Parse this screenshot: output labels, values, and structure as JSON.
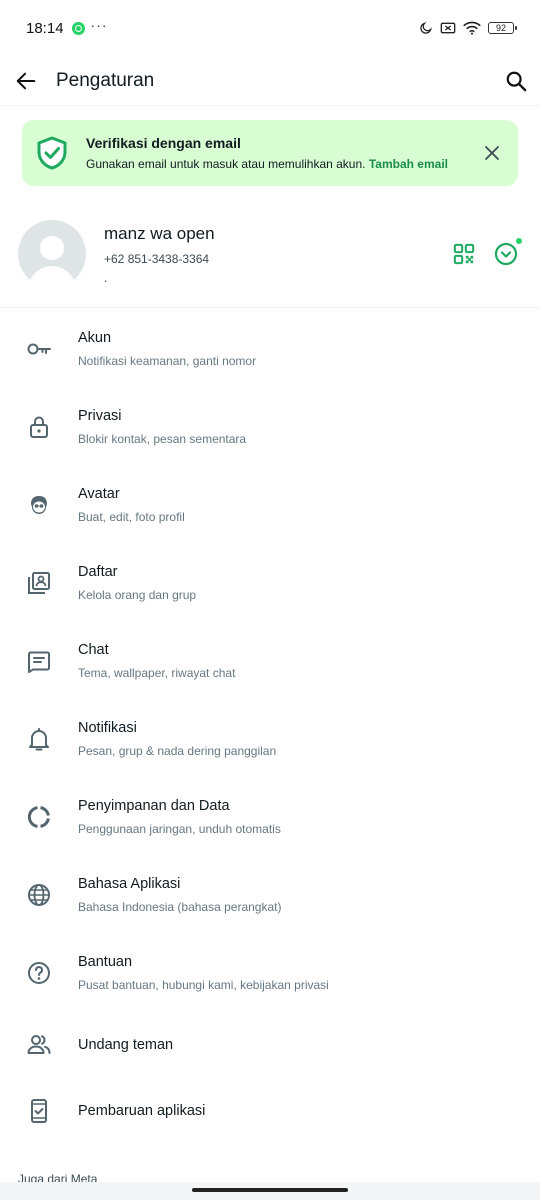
{
  "status_bar": {
    "time": "18:14",
    "dots": "···",
    "battery": "92",
    "icons": [
      "whatsapp-notification-icon",
      "moon-icon",
      "screen-record-icon",
      "wifi-icon",
      "battery-icon"
    ]
  },
  "app_bar": {
    "title": "Pengaturan",
    "icons": [
      "back-arrow-icon",
      "search-icon"
    ]
  },
  "email_banner": {
    "title": "Verifikasi dengan email",
    "description": "Gunakan email untuk masuk atau memulihkan akun.",
    "link": "Tambah email",
    "icons": [
      "shield-check-icon",
      "close-icon"
    ]
  },
  "profile": {
    "name": "manz wa open",
    "phone": "+62 851-3438-3364",
    "about": ".",
    "icons": [
      "qr-code-icon",
      "status-chevron-icon"
    ]
  },
  "settings": [
    {
      "title": "Akun",
      "subtitle": "Notifikasi keamanan, ganti nomor",
      "icon": "key-icon"
    },
    {
      "title": "Privasi",
      "subtitle": "Blokir kontak, pesan sementara",
      "icon": "lock-icon"
    },
    {
      "title": "Avatar",
      "subtitle": "Buat, edit, foto profil",
      "icon": "avatar-face-icon"
    },
    {
      "title": "Daftar",
      "subtitle": "Kelola orang dan grup",
      "icon": "contact-list-icon"
    },
    {
      "title": "Chat",
      "subtitle": "Tema, wallpaper, riwayat chat",
      "icon": "chat-icon"
    },
    {
      "title": "Notifikasi",
      "subtitle": "Pesan, grup & nada dering panggilan",
      "icon": "bell-icon"
    },
    {
      "title": "Penyimpanan dan Data",
      "subtitle": "Penggunaan jaringan, unduh otomatis",
      "icon": "storage-icon"
    },
    {
      "title": "Bahasa Aplikasi",
      "subtitle": "Bahasa Indonesia (bahasa perangkat)",
      "icon": "globe-icon"
    },
    {
      "title": "Bantuan",
      "subtitle": "Pusat bantuan, hubungi kami, kebijakan privasi",
      "icon": "help-icon"
    },
    {
      "title": "Undang teman",
      "subtitle": "",
      "icon": "invite-people-icon"
    },
    {
      "title": "Pembaruan aplikasi",
      "subtitle": "",
      "icon": "app-update-icon"
    }
  ],
  "footer": {
    "meta_label": "Juga dari Meta"
  },
  "colors": {
    "accent": "#1daa61",
    "banner_bg": "#d9fdd3",
    "link": "#1a8d4a",
    "icon_gray": "#54656f"
  }
}
